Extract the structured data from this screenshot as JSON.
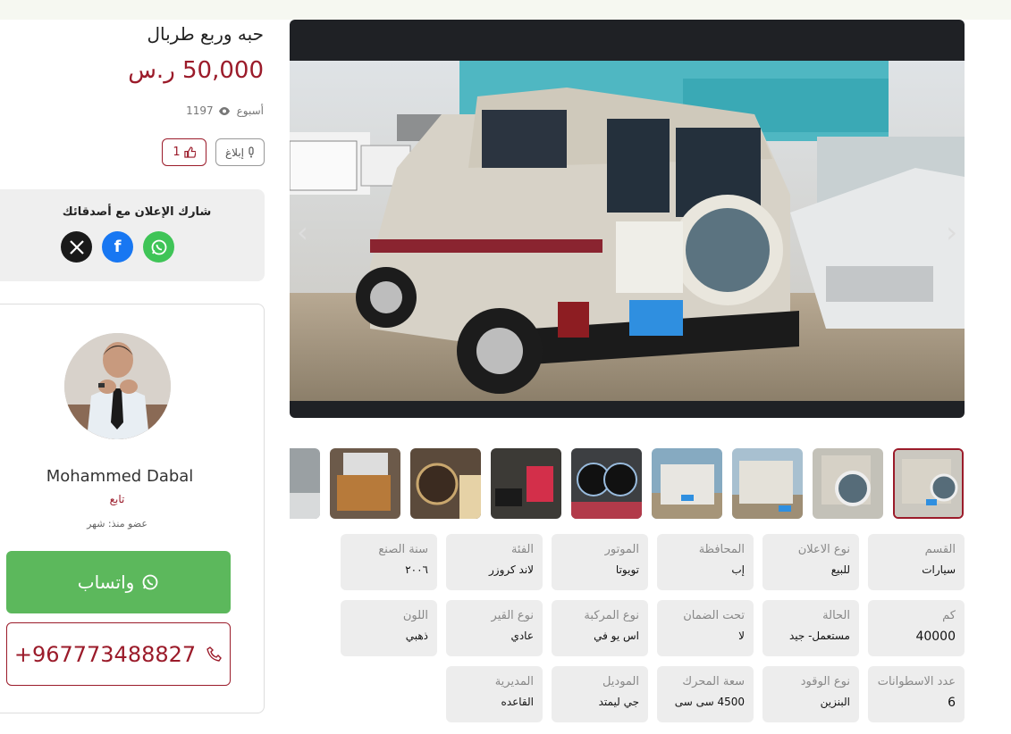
{
  "listing": {
    "title": "حبه وربع طربال",
    "price": "50,000 ر.س",
    "age": "أسبوع",
    "views": "1197",
    "likes": "1",
    "report_label": "إبلاغ"
  },
  "share": {
    "title": "شارك الإعلان مع أصدقائك",
    "icons": [
      "x-icon",
      "facebook-icon",
      "whatsapp-icon"
    ]
  },
  "seller": {
    "name": "Mohammed Dabal",
    "follow_label": "تابع",
    "member_since": "عضو منذ: شهر",
    "whatsapp_label": "واتساب",
    "phone": "+967773488827"
  },
  "gallery": {
    "prev_icon": "‹",
    "next_icon": "›",
    "thumbnail_count": 9
  },
  "details": [
    {
      "label": "القسم",
      "value": "سيارات"
    },
    {
      "label": "نوع الاعلان",
      "value": "للبيع"
    },
    {
      "label": "المحافظة",
      "value": "إب"
    },
    {
      "label": "الموتور",
      "value": "تويوتا"
    },
    {
      "label": "الفئة",
      "value": "لاند كروزر"
    },
    {
      "label": "سنة الصنع",
      "value": "٢٠٠٦"
    },
    {
      "label": "كم",
      "value": "40000"
    },
    {
      "label": "الحالة",
      "value": "مستعمل- جيد"
    },
    {
      "label": "تحت الضمان",
      "value": "لا"
    },
    {
      "label": "نوع المركبة",
      "value": "اس يو في"
    },
    {
      "label": "نوع القير",
      "value": "عادي"
    },
    {
      "label": "اللون",
      "value": "ذهبي"
    },
    {
      "label": "عدد الاسطوانات",
      "value": "6"
    },
    {
      "label": "نوع الوقود",
      "value": "البنزين"
    },
    {
      "label": "سعة المحرك",
      "value": "4500 سى سى"
    },
    {
      "label": "الموديل",
      "value": "جي ليمتد"
    },
    {
      "label": "المديرية",
      "value": "القاعده"
    }
  ],
  "colors": {
    "accent": "#9b1b2a",
    "whatsapp": "#5cb85c",
    "card_bg": "#ededed"
  }
}
